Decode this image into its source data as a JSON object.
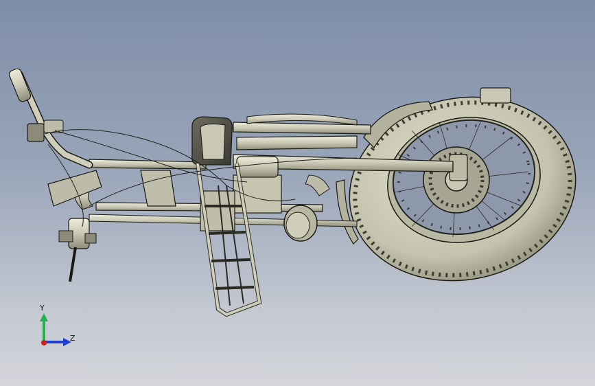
{
  "viewport": {
    "background_top": "#7e8ea8",
    "background_bottom": "#d4d6da",
    "model_fill": "#c9c8b4",
    "model_stroke": "#1a1a14"
  },
  "triad": {
    "y_label": "Y",
    "z_label": "Z",
    "y_color": "#22b14c",
    "z_color": "#1f3fd0",
    "x_color": "#d11f1f"
  }
}
